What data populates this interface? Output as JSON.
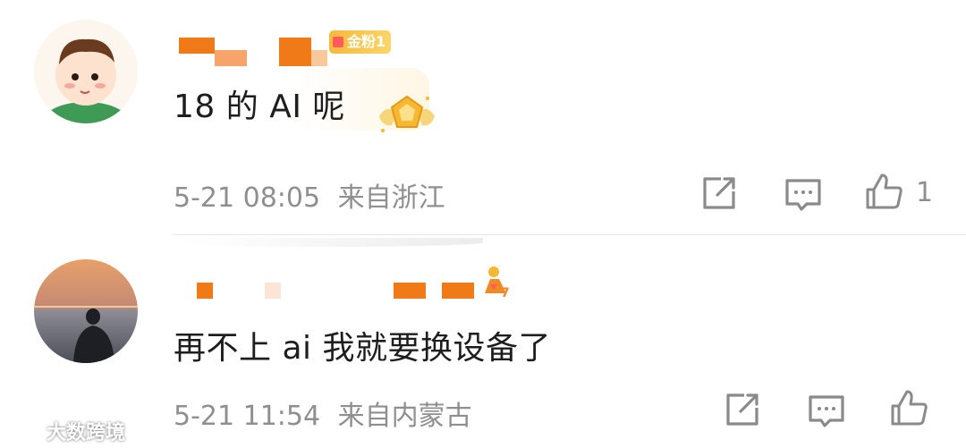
{
  "comments": [
    {
      "badge_text": "金粉1",
      "text": "18 的 AI 呢",
      "time": "5-21 08:05",
      "location": "来自浙江",
      "like_count": "1",
      "avatar_icon": "cartoon-baby-avatar"
    },
    {
      "text": "再不上 ai 我就要换设备了",
      "time": "5-21 11:54",
      "location": "来自内蒙古",
      "like_count": "",
      "avatar_icon": "sunset-sea-photo-avatar"
    }
  ],
  "watermark": {
    "text": "大数跨境"
  },
  "colors": {
    "name_mask_orange": "#f07a18",
    "name_mask_light": "#f6a469",
    "meta_gray": "#8f8f8f",
    "icon_gray": "#8a8a8a",
    "badge_gold": "#f6b83a"
  }
}
